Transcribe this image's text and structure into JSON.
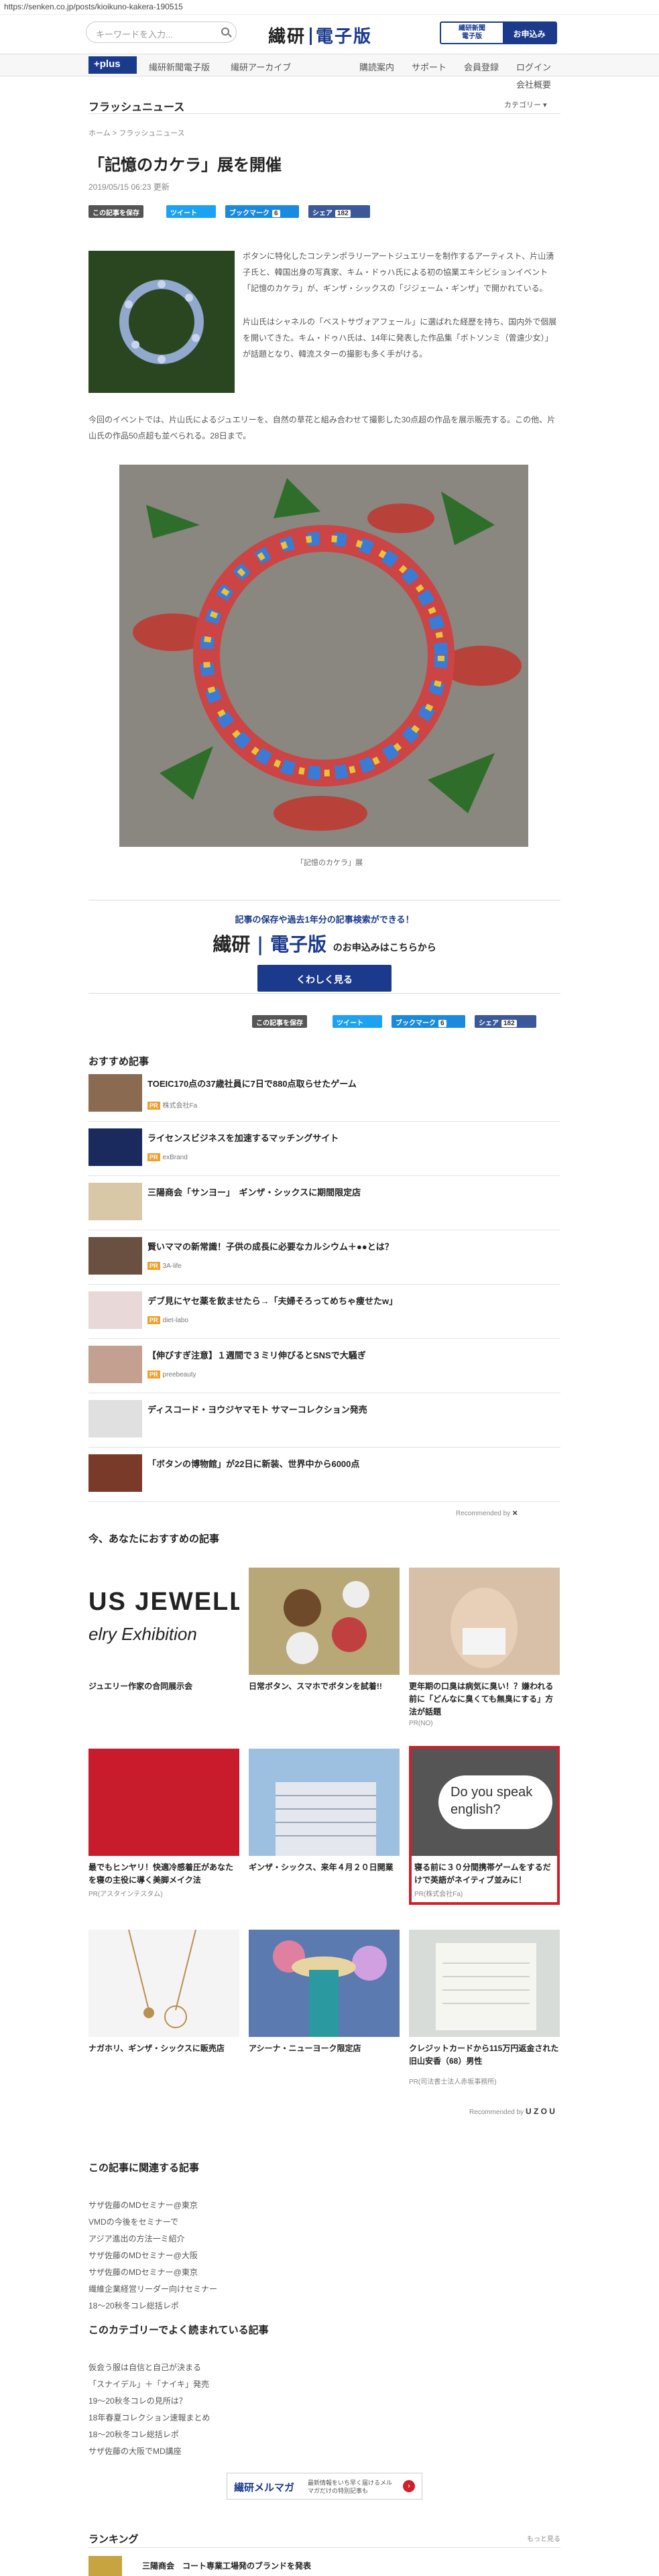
{
  "url": "https://senken.co.jp/posts/kioikuno-kakera-190515",
  "header": {
    "search_placeholder": "キーワードを入力...",
    "logo_left": "繊研",
    "logo_right": "電子版",
    "sub_l1": "繊研新聞",
    "sub_l2": "電子版",
    "subscribe": "お申込み"
  },
  "nav": {
    "plus": "+plus",
    "items": [
      "繊研新聞電子版",
      "繊研アーカイブ"
    ],
    "right": [
      "購読案内",
      "サポート",
      "会員登録",
      "ログイン"
    ],
    "row2": "会社概要"
  },
  "section": {
    "title": "フラッシュニュース",
    "category": "カテゴリー"
  },
  "article": {
    "breadcrumb": "ホーム > フラッシュニュース",
    "title": "「記憶のカケラ」展を開催",
    "date": "2019/05/15 06:23 更新",
    "p1": "ボタンに特化したコンテンポラリーアートジュエリーを制作するアーティスト、片山湧子氏と、韓国出身の写真家、キム・ドゥハ氏による初の協業エキシビションイベント「記憶のカケラ」が、ギンザ・シックスの「ジジェーム・ギンザ」で開かれている。",
    "p2": "片山氏はシャネルの「ベストサヴォアフェール」に選ばれた経歴を持ち、国内外で個展を開いてきた。キム・ドゥハ氏は、14年に発表した作品集「ボトソンミ（曾遠少女）」が話題となり、韓流スターの撮影も多く手がける。",
    "p3": "今回のイベントでは、片山氏によるジュエリーを、自然の草花と組み合わせて撮影した30点超の作品を展示販売する。この他、片山氏の作品50点超も並べられる。28日まで。",
    "caption": "「記憶のカケラ」展"
  },
  "share": {
    "save": "この記事を保存",
    "tweet": "ツイート",
    "hatena": "ブックマーク",
    "hatena_count": "6",
    "fb": "シェア",
    "fb_count": "182"
  },
  "promo": {
    "line1": "記事の保存や過去1年分の記事検索ができる！",
    "logo_left": "繊研",
    "logo_right": "電子版",
    "line2": "のお申込みはこちらから",
    "button": "くわしく見る"
  },
  "recs": {
    "heading": "おすすめ記事",
    "items": [
      {
        "title": "TOEIC170点の37歳社員に7日で880点取らせたゲーム",
        "source": "株式会社Fa"
      },
      {
        "title": "ライセンスビジネスを加速するマッチングサイト",
        "source": "exBrand"
      },
      {
        "title": "三陽商会「サンヨー」　ギンザ・シックスに期間限定店",
        "source": ""
      },
      {
        "title": "賢いママの新常識！子供の成長に必要なカルシウム＋●●とは？",
        "source": "3A-life"
      },
      {
        "title": "デブ見にヤセ薬を飲ませたら→「夫婦そろってめちゃ痩せたw」",
        "source": "diet-labo"
      },
      {
        "title": "【伸びすぎ注意】１週間で３ミリ伸びるとSNSで大騒ぎ",
        "source": "preebeauty"
      },
      {
        "title": "ディスコード・ヨウジヤマモト サマーコレクション発売",
        "source": ""
      },
      {
        "title": "「ボタンの博物館」が22日に新装、世界中から6000点",
        "source": ""
      }
    ],
    "credit": "Recommended by"
  },
  "now": {
    "heading": "今、あなたにおすすめの記事",
    "cards": [
      {
        "title": "ジュエリー作家の合同展示会",
        "source": "",
        "img_text": "US JEWELL",
        "img_sub": "elry Exhibition"
      },
      {
        "title": "日常ボタン、スマホでボタンを試着!!",
        "source": ""
      },
      {
        "title": "更年期の口臭は病気に臭い！？嫌われる前に「どんなに臭くても無臭にする」方法が話題",
        "source": "PR(NO)"
      },
      {
        "title": "最でもヒンヤリ！快適冷感着圧があなたを寝の主役に導く美脚メイク法",
        "source": "PR(アスタインテスタム)"
      },
      {
        "title": "ギンザ・シックス、来年４月２０日開業",
        "source": ""
      },
      {
        "title": "寝る前に３０分間携帯ゲームをするだけで英語がネイティブ並みに！",
        "source": "PR(株式会社Fa)",
        "img_text": "Do you speak english?"
      },
      {
        "title": "ナガホリ、ギンザ・シックスに販売店",
        "source": ""
      },
      {
        "title": "アシーナ・ニューヨーク限定店",
        "source": ""
      },
      {
        "title": "クレジットカードから115万円返金された旧山安香（68）男性",
        "source": "PR(司法書士法人赤坂事務所)"
      }
    ],
    "credit": "Recommended by",
    "credit_brand": "U Z O U"
  },
  "related": {
    "heading": "この記事に関連する記事",
    "items": [
      "サザ佐藤のMDセミナー@東京",
      "VMDの今後をセミナーで",
      "アジア進出の方法一ミ紹介",
      "サザ佐藤のMDセミナー@大阪",
      "サザ佐藤のMDセミナー@東京",
      "繊維企業経営リーダー向けセミナー",
      "18～20秋冬コレ総括レポ"
    ]
  },
  "popular": {
    "heading": "このカテゴリーでよく読まれている記事",
    "items": [
      "仮会う服は自信と自己が決まる",
      "「スナイデル」＋「ナイキ」発売",
      "19～20秋冬コレの見所は？",
      "18年春夏コレクション速報まとめ",
      "18～20秋冬コレ総括レポ",
      "サザ佐藤の大阪でMD講座"
    ]
  },
  "mailmag": {
    "title": "繊研メルマガ",
    "text": "最新情報をいち早く届けるメルマガだけの特別記事も"
  },
  "ranking": {
    "heading": "ランキング",
    "more": "もっと見る",
    "first": "三陽商会　コート専業工場発のブランドを発表"
  }
}
